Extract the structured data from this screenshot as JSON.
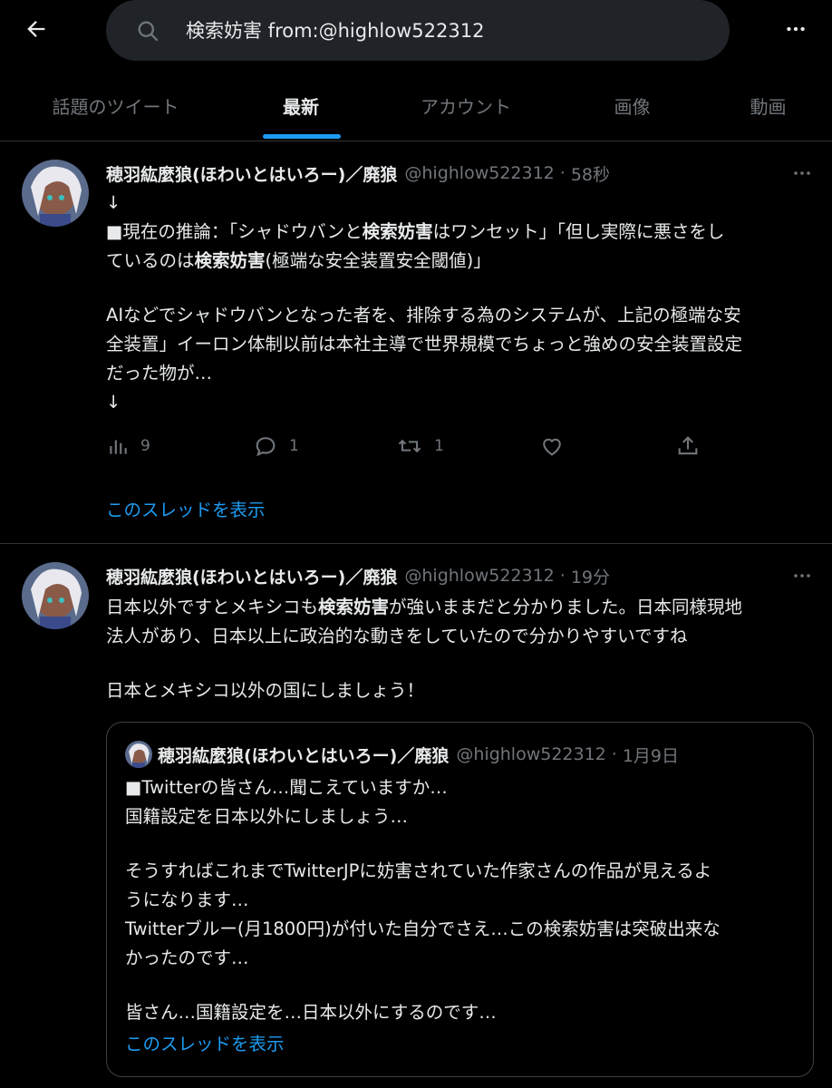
{
  "search": {
    "query": "検索妨害 from:@highlow522312"
  },
  "tabs": [
    {
      "label": "話題のツイート"
    },
    {
      "label": "最新"
    },
    {
      "label": "アカウント"
    },
    {
      "label": "画像"
    },
    {
      "label": "動画"
    }
  ],
  "tweets": [
    {
      "author": "穂羽紘麼狼(ほわいとはいろー)／廃狼",
      "handle": "@highlow522312",
      "time": "58秒",
      "lines": [
        "↓",
        "■現在の推論：「シャドウバンと",
        "検索妨害",
        "はワンセット」「但し実際に悪さをし",
        "ているのは",
        "検索妨害",
        "(極端な安全装置安全閾値)」",
        "AIなどでシャドウバンとなった者を、排除する為のシステムが、上記の極端な安",
        "全装置」イーロン体制以前は本社主導で世界規模でちょっと強めの安全装置設定",
        "だった物が…",
        "↓"
      ],
      "stats": {
        "views": "9",
        "replies": "1",
        "retweets": "1",
        "likes": "",
        "share": ""
      },
      "thread_link": "このスレッドを表示"
    },
    {
      "author": "穂羽紘麼狼(ほわいとはいろー)／廃狼",
      "handle": "@highlow522312",
      "time": "19分",
      "lines": [
        "日本以外ですとメキシコも",
        "検索妨害",
        "が強いままだと分かりました。日本同様現地",
        "法人があり、日本以上に政治的な動きをしていたので分かりやすいですね",
        "日本とメキシコ以外の国にしましょう！"
      ],
      "quote": {
        "author": "穂羽紘麼狼(ほわいとはいろー)／廃狼",
        "handle": "@highlow522312",
        "time": "1月9日",
        "lines": [
          "■Twitterの皆さん…聞こえていますか…",
          "国籍設定を日本以外にしましょう…",
          "そうすればこれまでTwitterJPに妨害されていた作家さんの作品が見えるよ",
          "うになります…",
          "Twitterブルー(月1800円)が付いた自分でさえ…この検索妨害は突破出来な",
          "かったのです…",
          "皆さん…国籍設定を…日本以外にするのです…"
        ],
        "thread_link": "このスレッドを表示"
      }
    }
  ],
  "separator": "·",
  "colors": {
    "accent": "#1d9bf0",
    "muted": "#71767b",
    "text": "#e7e9ea",
    "background": "#000000"
  }
}
